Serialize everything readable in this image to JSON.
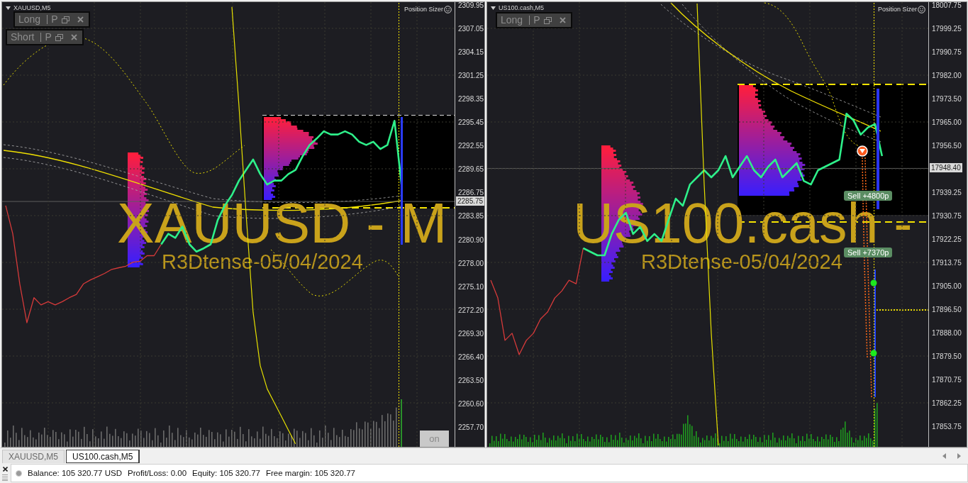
{
  "charts": [
    {
      "symbol": "XAUUSD,M5",
      "tool_label": "Position Sizer",
      "panels": [
        {
          "label": "Long",
          "button": "P"
        },
        {
          "label": "Short",
          "button": "P"
        }
      ],
      "background_label": "XAUUSD - M",
      "signature": "R3Dtense-05/04/2024",
      "current_price": "2285.75",
      "toggle_button": "on",
      "chart_data": {
        "type": "line",
        "grid": true,
        "ylim": [
          2255.33,
          2310.39
        ],
        "yticks": [
          2309.95,
          2307.05,
          2304.15,
          2301.25,
          2298.35,
          2295.45,
          2292.55,
          2289.65,
          2286.75,
          2283.85,
          {
            "value": 2280.9,
            "label": "2280.90"
          },
          {
            "value": 2278,
            "label": "2278.00"
          },
          {
            "value": 2275.1,
            "label": "2275.10"
          },
          {
            "value": 2272.2,
            "label": "2272.20"
          },
          {
            "value": 2269.3,
            "label": "2269.30"
          },
          {
            "value": 2266.4,
            "label": "2266.40"
          },
          {
            "value": 2263.5,
            "label": "2263.50"
          },
          {
            "value": 2260.6,
            "label": "2260.60"
          },
          {
            "value": 2257.7,
            "label": "2257.70"
          }
        ],
        "series": [
          {
            "color": "#d63a3a",
            "values": [
              2285.2,
              2281.7,
              2275.5,
              2270.7,
              2273.8,
              2272.9,
              2273.3,
              2272.9,
              2273.3,
              2273.8,
              2274.2,
              2275.5,
              2276.0,
              2276.4,
              2276.8,
              2277.3,
              2277.5,
              2277.7,
              2278.2,
              2278.3,
              2279.0,
              2279.0,
              2280.4,
              null,
              null,
              null,
              null,
              null,
              null,
              null,
              null,
              null,
              null,
              null,
              null,
              null,
              null,
              null,
              null,
              null,
              null,
              null,
              null,
              null,
              null,
              null,
              null,
              null,
              null,
              null,
              null,
              null,
              null,
              null,
              null,
              null,
              null,
              null,
              null,
              null,
              null,
              null,
              null,
              null
            ]
          },
          {
            "color": "#2ef08a",
            "values": [
              null,
              null,
              null,
              null,
              null,
              null,
              null,
              null,
              null,
              null,
              null,
              null,
              null,
              null,
              null,
              null,
              null,
              null,
              null,
              null,
              null,
              null,
              2280.4,
              2281.7,
              2281.2,
              2282.6,
              2280.4,
              2279.5,
              2279.9,
              2280.4,
              2283.4,
              2285.2,
              2286.5,
              2288.3,
              2289.6,
              2290.9,
              2289.1,
              2287.8,
              2288.3,
              2288.3,
              2289.1,
              2289.6,
              2291.3,
              2292.7,
              2293.5,
              2294.4,
              2294.0,
              2294.0,
              2294.4,
              2294.0,
              2293.1,
              2292.7,
              2293.1,
              2292.2,
              2292.7,
              2295.7,
              2287.8,
              null,
              null,
              null,
              null,
              null,
              null,
              null
            ]
          },
          {
            "color": "#e6e000",
            "values": [
              null,
              null,
              null,
              null,
              null,
              null,
              null,
              null,
              null,
              null,
              null,
              null,
              null,
              null,
              null,
              null,
              null,
              null,
              null,
              null,
              null,
              null,
              null,
              null,
              null,
              null,
              null,
              null,
              null,
              null,
              null,
              null,
              2309.8,
              2297.5,
              2284.3,
              2272.0,
              2265.4,
              2262.5,
              2260.8,
              2259.1,
              2257.4,
              2255.7,
              null,
              null,
              null,
              null,
              null,
              null,
              null,
              null,
              null,
              null,
              null,
              null,
              null,
              null,
              null,
              null,
              null,
              null,
              null,
              null,
              null,
              null
            ]
          }
        ]
      }
    },
    {
      "symbol": "US100.cash,M5",
      "tool_label": "Position Sizer",
      "panels": [
        {
          "label": "Long",
          "button": "P"
        }
      ],
      "background_label": "US100.cash -",
      "signature": "R3Dtense-05/04/2024",
      "current_price": "17948.40",
      "trade_labels": [
        "Sell +4800p",
        "Sell +7370p"
      ],
      "chart_data": {
        "type": "line",
        "grid": true,
        "ylim": [
          17846.49,
          18009.05
        ],
        "yticks": [
          18007.75,
          17999.25,
          17990.75,
          {
            "value": 17982,
            "label": "17982.00"
          },
          {
            "value": 17973.5,
            "label": "17973.50"
          },
          {
            "value": 17965,
            "label": "17965.00"
          },
          {
            "value": 17956.5,
            "label": "17956.50"
          },
          17939.25,
          17930.75,
          17922.25,
          17913.75,
          {
            "value": 17905,
            "label": "17905.00"
          },
          {
            "value": 17896.5,
            "label": "17896.50"
          },
          {
            "value": 17888,
            "label": "17888.00"
          },
          {
            "value": 17879.5,
            "label": "17879.50"
          },
          17870.75,
          17862.25,
          17853.75
        ],
        "series": [
          {
            "color": "#d63a3a",
            "values": [
              17907.4,
              17900.9,
              17885.4,
              17888.0,
              17880.2,
              17885.4,
              17888.0,
              17893.2,
              17895.8,
              17900.9,
              17903.5,
              17907.4,
              17906.1,
              17919.1,
              null,
              null,
              null,
              null,
              null,
              null,
              null,
              null,
              null,
              null,
              null,
              null,
              null,
              null,
              null,
              null,
              null,
              null,
              null,
              null,
              null,
              null,
              null,
              null,
              null,
              null,
              null,
              null,
              null,
              null,
              null,
              null,
              null,
              null,
              null,
              null,
              null,
              null,
              null,
              null,
              null,
              null,
              null,
              null,
              null,
              null,
              null,
              null
            ]
          },
          {
            "color": "#2ef08a",
            "values": [
              null,
              null,
              null,
              null,
              null,
              null,
              null,
              null,
              null,
              null,
              null,
              null,
              null,
              17919.1,
              17917.8,
              17916.5,
              17916.5,
              17924.3,
              17929.5,
              17932.1,
              17924.3,
              17926.9,
              17921.7,
              17924.3,
              17921.7,
              17929.5,
              17937.2,
              17934.6,
              17942.4,
              17945.0,
              17947.6,
              17945.0,
              17947.6,
              17952.8,
              17945.0,
              17948.9,
              17952.8,
              17947.6,
              17945.0,
              17948.9,
              17951.5,
              17945.0,
              17947.6,
              17950.2,
              17943.7,
              17942.4,
              17947.6,
              17948.9,
              17950.2,
              17951.5,
              17968.3,
              17965.8,
              17960.6,
              17963.2,
              17964.5,
              17952.8,
              null,
              null,
              null,
              null,
              null,
              null
            ]
          },
          {
            "color": "#e6e000",
            "values": [
              null,
              null,
              null,
              null,
              null,
              null,
              null,
              null,
              null,
              null,
              null,
              null,
              null,
              null,
              null,
              null,
              null,
              null,
              null,
              null,
              null,
              null,
              null,
              null,
              null,
              null,
              null,
              null,
              null,
              18008.5,
              17942.4,
              17888.0,
              17847.0,
              null,
              null,
              null,
              null,
              null,
              null,
              null,
              null,
              null,
              null,
              null,
              null,
              null,
              null,
              null,
              null,
              null,
              null,
              null,
              null,
              null,
              null,
              null,
              null,
              null,
              null,
              null,
              null,
              null
            ]
          }
        ]
      }
    }
  ],
  "tabs": [
    {
      "label": "XAUUSD,M5",
      "selected": false
    },
    {
      "label": "US100.cash,M5",
      "selected": true
    }
  ],
  "status_bar": {
    "items": [
      "Balance: 105 320.77 USD",
      "Profit/Loss: 0.00",
      "Equity: 105 320.77",
      "Free margin: 105 320.77"
    ]
  }
}
